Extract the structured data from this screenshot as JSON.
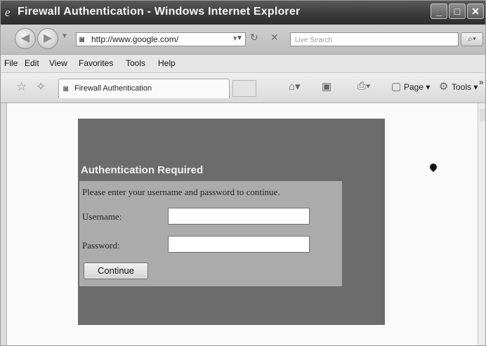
{
  "window": {
    "title": "Firewall Authentication - Windows Internet Explorer",
    "controls": {
      "minimize": "_",
      "maximize": "□",
      "close": "✕"
    }
  },
  "address_bar": {
    "url": "http://www.google.com/",
    "search_placeholder": "Live Search"
  },
  "menu": [
    "File",
    "Edit",
    "View",
    "Favorites",
    "Tools",
    "Help"
  ],
  "command_bar": {
    "tab_title": "Firewall Authentication",
    "page_label": "Page",
    "tools_label": "Tools",
    "overflow": "»"
  },
  "auth": {
    "heading": "Authentication Required",
    "prompt": "Please enter your username and password to continue.",
    "username_label": "Username:",
    "password_label": "Password:",
    "username_value": "",
    "password_value": "",
    "continue_label": "Continue"
  },
  "icons": {
    "back": "back-arrow-icon",
    "forward": "forward-arrow-icon",
    "refresh": "refresh-icon",
    "stop": "stop-icon",
    "search": "search-icon",
    "favorites": "favorites-star-icon",
    "add_favorite": "add-favorite-icon",
    "home": "home-icon",
    "feeds": "feeds-icon",
    "print": "print-icon",
    "page": "page-icon",
    "tools": "gear-icon"
  },
  "colors": {
    "titlebar": "#3b3b3b",
    "auth_panel": "#6c6c6c",
    "auth_form": "#ababab"
  }
}
